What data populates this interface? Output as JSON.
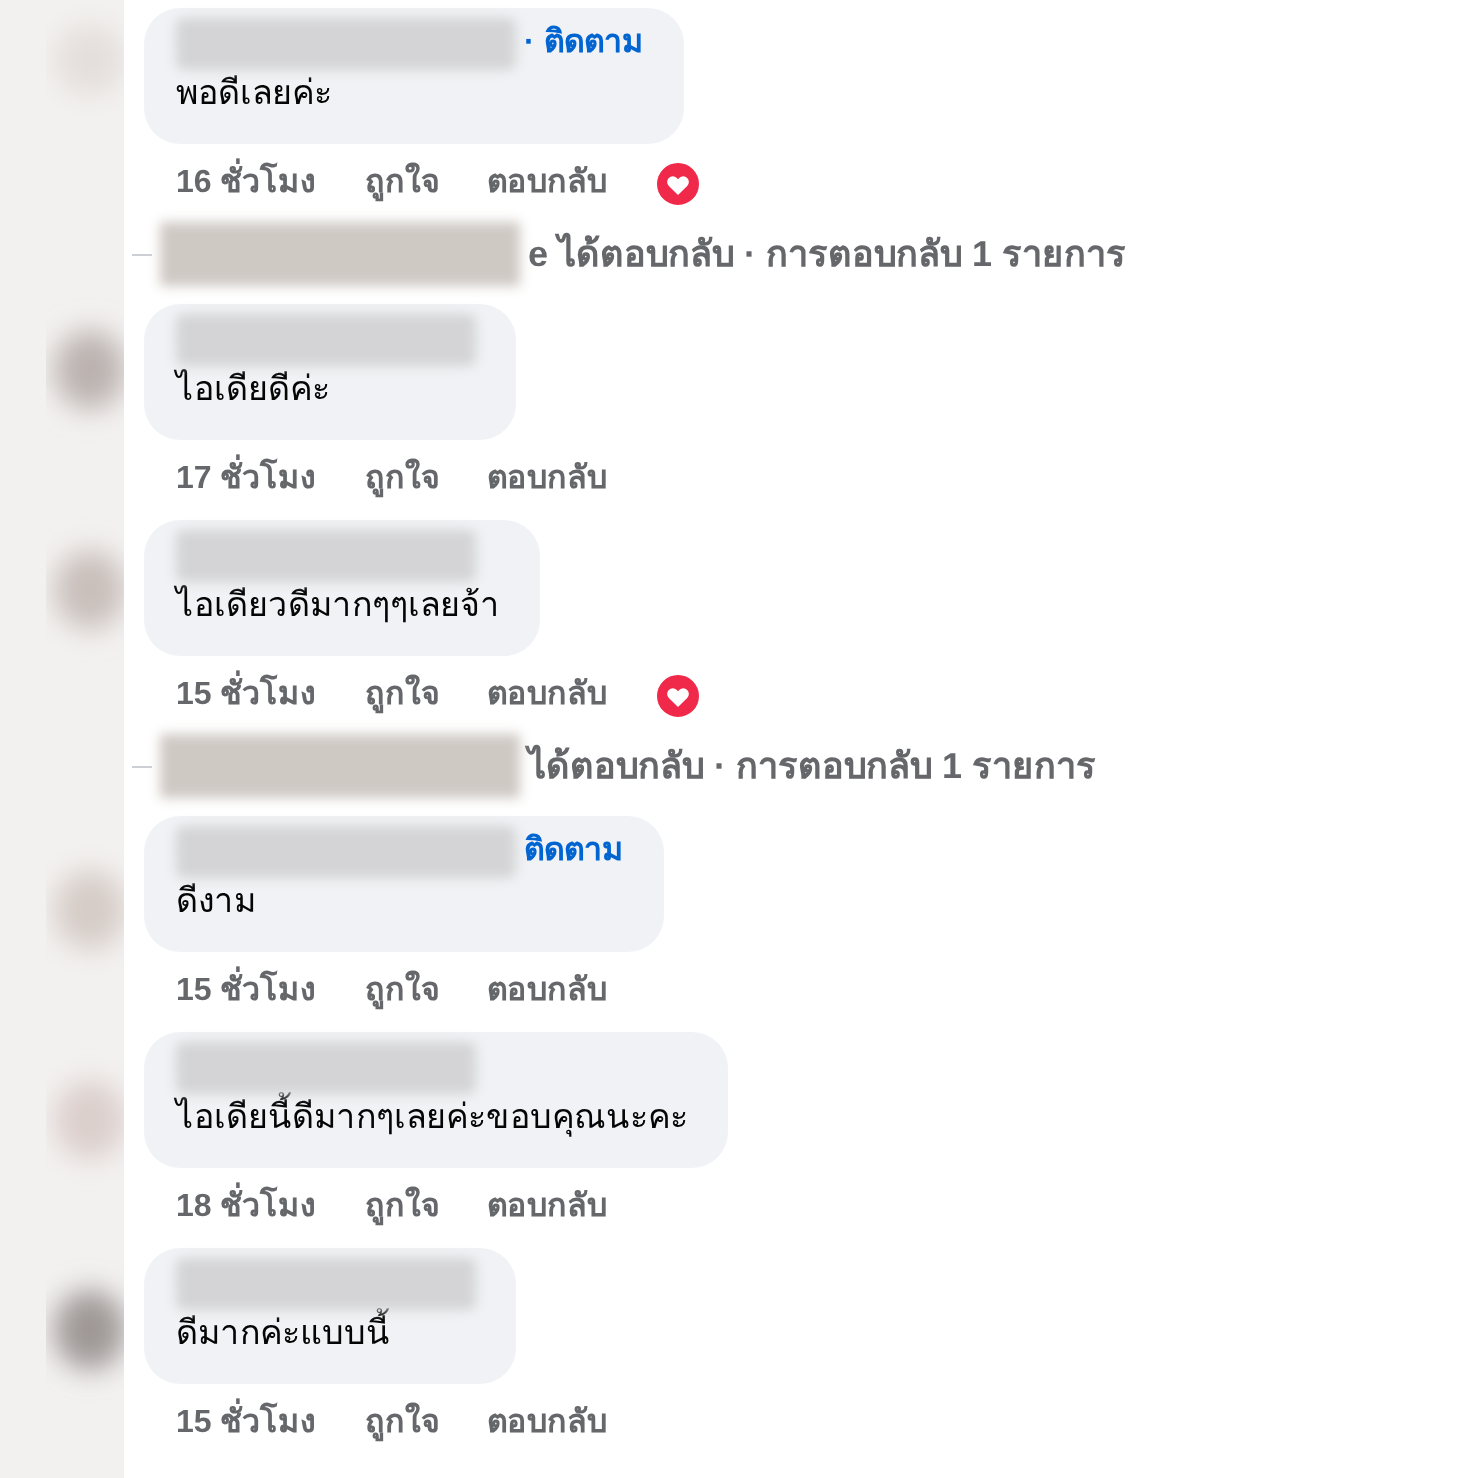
{
  "items": [
    {
      "kind": "comment",
      "follow": "· ติดตาม",
      "text": "พอดีเลยค่ะ",
      "time": "16 ชั่วโมง",
      "like": "ถูกใจ",
      "reply": "ตอบกลับ",
      "reacted": true
    },
    {
      "kind": "replies",
      "text": "e ได้ตอบกลับ · การตอบกลับ 1 รายการ"
    },
    {
      "kind": "comment",
      "text": "ไอเดียดีค่ะ",
      "time": "17 ชั่วโมง",
      "like": "ถูกใจ",
      "reply": "ตอบกลับ",
      "reacted": false
    },
    {
      "kind": "comment",
      "text": "ไอเดียวดีมากๆๆเลยจ้า",
      "time": "15 ชั่วโมง",
      "like": "ถูกใจ",
      "reply": "ตอบกลับ",
      "reacted": true
    },
    {
      "kind": "replies",
      "text": "ได้ตอบกลับ · การตอบกลับ 1 รายการ"
    },
    {
      "kind": "comment",
      "follow": "ติดตาม",
      "text": "ดีงาม",
      "time": "15 ชั่วโมง",
      "like": "ถูกใจ",
      "reply": "ตอบกลับ",
      "reacted": false
    },
    {
      "kind": "comment",
      "text": "ไอเดียนี้ดีมากๆเลยค่ะขอบคุณนะคะ",
      "time": "18 ชั่วโมง",
      "like": "ถูกใจ",
      "reply": "ตอบกลับ",
      "reacted": false
    },
    {
      "kind": "comment",
      "text": "ดีมากค่ะแบบนี้",
      "time": "15 ชั่วโมง",
      "like": "ถูกใจ",
      "reply": "ตอบกลับ",
      "reacted": false
    }
  ]
}
